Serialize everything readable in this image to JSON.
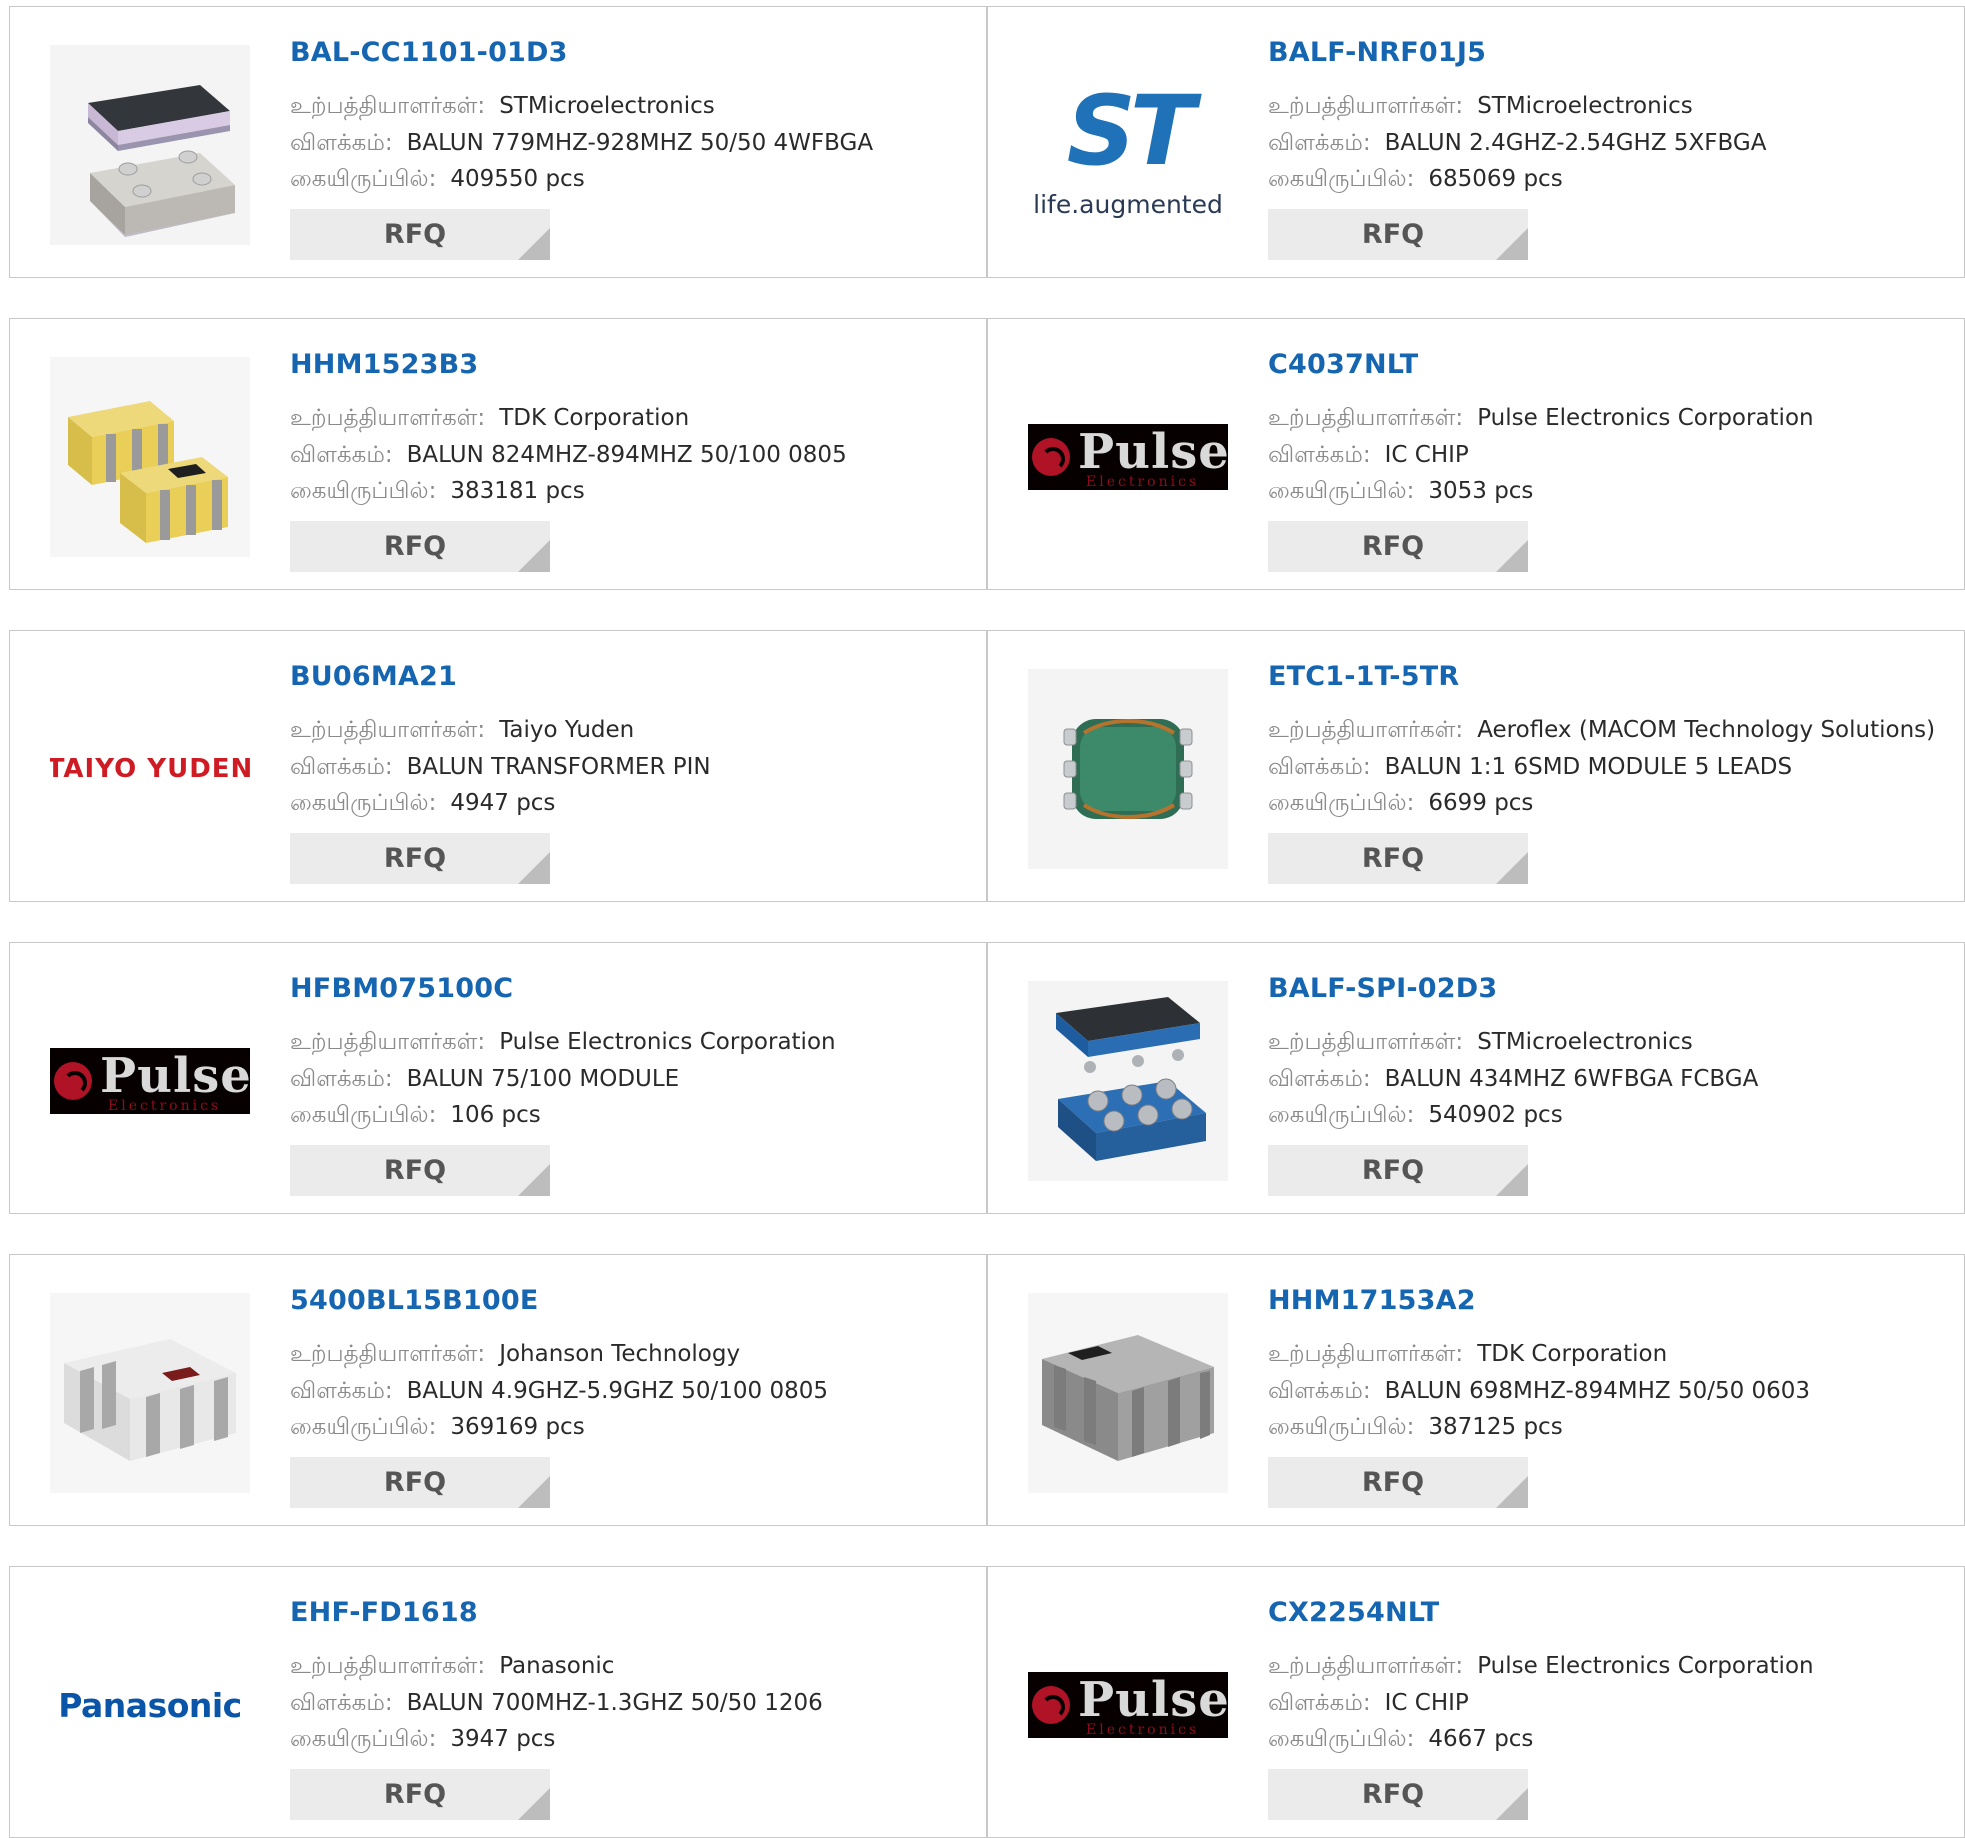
{
  "labels": {
    "manufacturer": "உற்பத்தியாளர்கள்:",
    "description": "விளக்கம்:",
    "stock": "கையிருப்பில்:"
  },
  "products": [
    {
      "part": "BAL-CC1101-01D3",
      "manufacturer": "STMicroelectronics",
      "description": "BALUN 779MHZ-928MHZ 50/50 4WFBGA",
      "stock": "409550 pcs",
      "rfq": "RFQ",
      "image": "chip-bga-purple"
    },
    {
      "part": "BALF-NRF01J5",
      "manufacturer": "STMicroelectronics",
      "description": "BALUN 2.4GHZ-2.54GHZ 5XFBGA",
      "stock": "685069 pcs",
      "rfq": "RFQ",
      "image": "st-logo",
      "logo_text": "ST",
      "logo_tagline": "life.augmented"
    },
    {
      "part": "HHM1523B3",
      "manufacturer": "TDK Corporation",
      "description": "BALUN 824MHZ-894MHZ 50/100 0805",
      "stock": "383181 pcs",
      "rfq": "RFQ",
      "image": "chip-yellow-pair"
    },
    {
      "part": "C4037NLT",
      "manufacturer": "Pulse Electronics Corporation",
      "description": "IC CHIP",
      "stock": "3053 pcs",
      "rfq": "RFQ",
      "image": "pulse-logo",
      "logo_text": "Pulse",
      "logo_sub": "Electronics"
    },
    {
      "part": "BU06MA21",
      "manufacturer": "Taiyo Yuden",
      "description": "BALUN TRANSFORMER PIN",
      "stock": "4947 pcs",
      "rfq": "RFQ",
      "image": "taiyo-logo",
      "logo_text": "TAIYO YUDEN"
    },
    {
      "part": "ETC1-1T-5TR",
      "manufacturer": "Aeroflex (MACOM Technology Solutions)",
      "description": "BALUN 1:1 6SMD MODULE 5 LEADS",
      "stock": "6699 pcs",
      "rfq": "RFQ",
      "image": "chip-green-transformer"
    },
    {
      "part": "HFBM075100C",
      "manufacturer": "Pulse Electronics Corporation",
      "description": "BALUN 75/100 MODULE",
      "stock": "106 pcs",
      "rfq": "RFQ",
      "image": "pulse-logo",
      "logo_text": "Pulse",
      "logo_sub": "Electronics"
    },
    {
      "part": "BALF-SPI-02D3",
      "manufacturer": "STMicroelectronics",
      "description": "BALUN 434MHZ 6WFBGA FCBGA",
      "stock": "540902 pcs",
      "rfq": "RFQ",
      "image": "chip-bga-blue"
    },
    {
      "part": "5400BL15B100E",
      "manufacturer": "Johanson Technology",
      "description": "BALUN 4.9GHZ-5.9GHZ 50/100 0805",
      "stock": "369169 pcs",
      "rfq": "RFQ",
      "image": "chip-white"
    },
    {
      "part": "HHM17153A2",
      "manufacturer": "TDK Corporation",
      "description": "BALUN 698MHZ-894MHZ 50/50 0603",
      "stock": "387125 pcs",
      "rfq": "RFQ",
      "image": "chip-gray"
    },
    {
      "part": "EHF-FD1618",
      "manufacturer": "Panasonic",
      "description": "BALUN 700MHZ-1.3GHZ 50/50 1206",
      "stock": "3947 pcs",
      "rfq": "RFQ",
      "image": "panasonic-logo",
      "logo_text": "Panasonic"
    },
    {
      "part": "CX2254NLT",
      "manufacturer": "Pulse Electronics Corporation",
      "description": "IC CHIP",
      "stock": "4667 pcs",
      "rfq": "RFQ",
      "image": "pulse-logo",
      "logo_text": "Pulse",
      "logo_sub": "Electronics"
    }
  ]
}
